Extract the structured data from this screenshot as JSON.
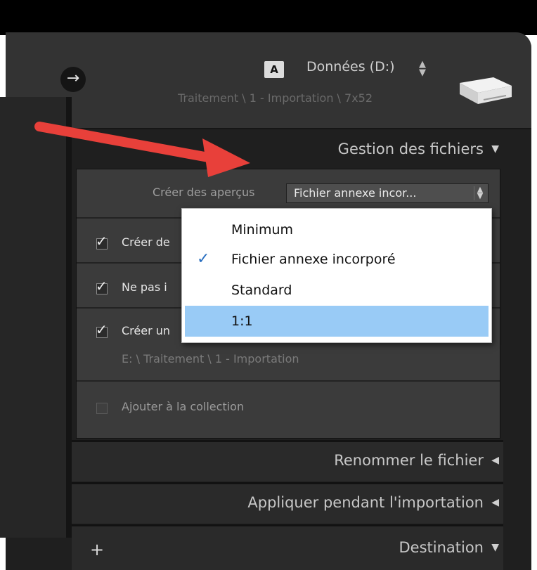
{
  "header": {
    "drive_badge": "A",
    "drive_name": "Données (D:)",
    "drive_updown_icon": "updown-arrows",
    "path": "Traitement \\ 1 - Importation \\ 7x52",
    "nav_icon": "arrow-right-circle",
    "drive_icon": "hard-drive"
  },
  "file_handling": {
    "title": "Gestion des fichiers",
    "title_icon": "triangle-down",
    "previews_label": "Créer des aperçus",
    "previews_value": "Fichier annexe incor...",
    "rows": [
      {
        "label": "Créer de",
        "checked": true
      },
      {
        "label": "Ne pas i",
        "checked": true
      },
      {
        "label": "Créer un",
        "checked": true
      }
    ],
    "backup_path": "E: \\ Traitement \\ 1 - Importation",
    "add_collection_label": "Ajouter à la collection",
    "add_collection_checked": false
  },
  "dropdown": {
    "options": [
      {
        "label": "Minimum",
        "checked": false,
        "highlighted": false
      },
      {
        "label": "Fichier annexe incorporé",
        "checked": true,
        "highlighted": false
      },
      {
        "label": "Standard",
        "checked": false,
        "highlighted": false
      },
      {
        "label": "1:1",
        "checked": false,
        "highlighted": true
      }
    ]
  },
  "sections": {
    "rename_title": "Renommer le fichier",
    "apply_title": "Appliquer pendant l'importation",
    "destination_title": "Destination",
    "collapsed_icon": "triangle-left",
    "expanded_icon": "triangle-down",
    "plus_icon": "plus"
  },
  "colors": {
    "panel_bg": "#3b3b3b",
    "header_bg": "#333333",
    "highlight": "#99cbf6",
    "annotation_arrow": "#e8403a"
  }
}
